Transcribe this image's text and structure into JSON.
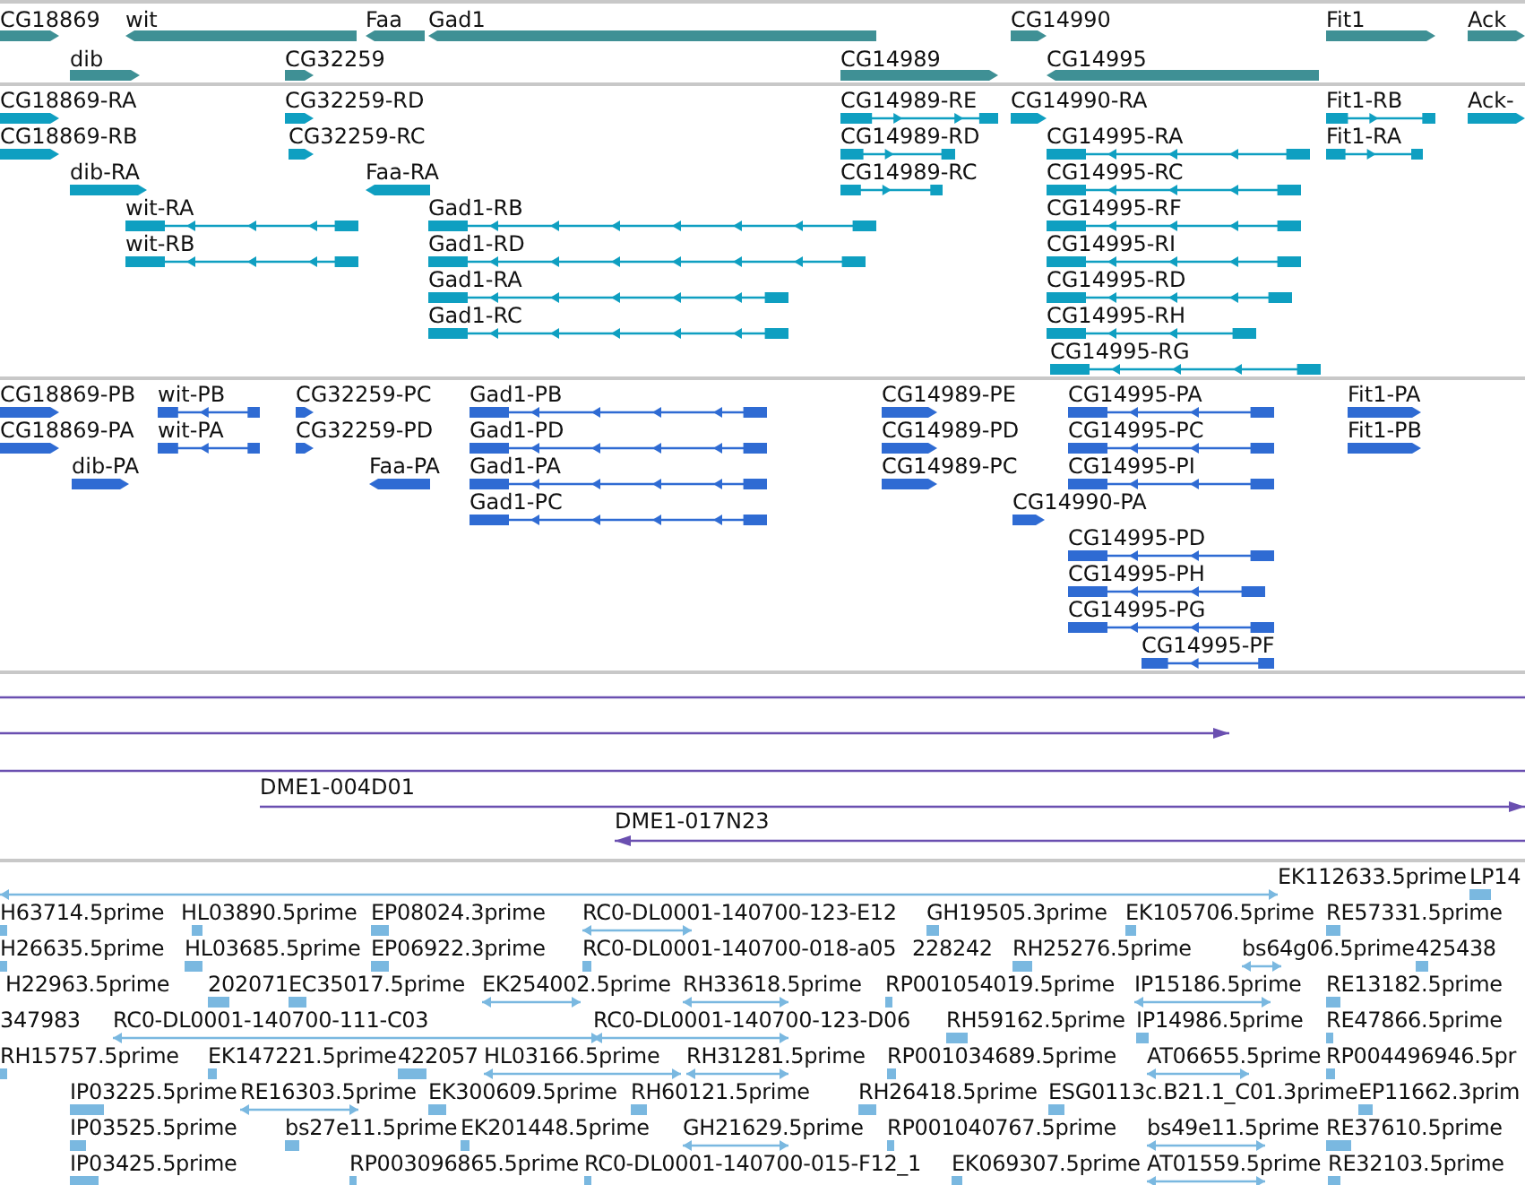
{
  "tracks": [
    {
      "kind": "genes",
      "features": [
        {
          "label": "CG18869",
          "reverse": false
        },
        {
          "label": "wit",
          "reverse": true
        },
        {
          "label": "Faa",
          "reverse": true
        },
        {
          "label": "Gad1",
          "reverse": true
        },
        {
          "label": "CG14990",
          "reverse": false
        },
        {
          "label": "Fit1",
          "reverse": false
        },
        {
          "label": "Ack",
          "reverse": false
        },
        {
          "label": "dib",
          "reverse": false
        },
        {
          "label": "CG32259",
          "reverse": false
        },
        {
          "label": "CG14989",
          "reverse": false
        },
        {
          "label": "CG14995",
          "reverse": true
        }
      ]
    },
    {
      "kind": "transcripts",
      "features": [
        {
          "label": "CG18869-RA",
          "reverse": false
        },
        {
          "label": "CG32259-RD",
          "reverse": false
        },
        {
          "label": "CG14989-RE",
          "reverse": false
        },
        {
          "label": "CG14990-RA",
          "reverse": false
        },
        {
          "label": "Fit1-RB",
          "reverse": false
        },
        {
          "label": "Ack-",
          "reverse": false
        },
        {
          "label": "CG18869-RB",
          "reverse": false
        },
        {
          "label": "CG32259-RC",
          "reverse": false
        },
        {
          "label": "CG14989-RD",
          "reverse": false
        },
        {
          "label": "CG14995-RA",
          "reverse": true
        },
        {
          "label": "Fit1-RA",
          "reverse": false
        },
        {
          "label": "dib-RA",
          "reverse": false
        },
        {
          "label": "Faa-RA",
          "reverse": true
        },
        {
          "label": "CG14989-RC",
          "reverse": false
        },
        {
          "label": "CG14995-RC",
          "reverse": true
        },
        {
          "label": "wit-RA",
          "reverse": true
        },
        {
          "label": "Gad1-RB",
          "reverse": true
        },
        {
          "label": "CG14995-RF",
          "reverse": true
        },
        {
          "label": "wit-RB",
          "reverse": true
        },
        {
          "label": "Gad1-RD",
          "reverse": true
        },
        {
          "label": "CG14995-RI",
          "reverse": true
        },
        {
          "label": "Gad1-RA",
          "reverse": true
        },
        {
          "label": "CG14995-RD",
          "reverse": true
        },
        {
          "label": "Gad1-RC",
          "reverse": true
        },
        {
          "label": "CG14995-RH",
          "reverse": true
        },
        {
          "label": "CG14995-RG",
          "reverse": true
        }
      ]
    },
    {
      "kind": "proteins",
      "features": [
        {
          "label": "CG18869-PB",
          "reverse": false
        },
        {
          "label": "wit-PB",
          "reverse": true
        },
        {
          "label": "CG32259-PC",
          "reverse": false
        },
        {
          "label": "Gad1-PB",
          "reverse": true
        },
        {
          "label": "CG14989-PE",
          "reverse": false
        },
        {
          "label": "CG14995-PA",
          "reverse": true
        },
        {
          "label": "Fit1-PA",
          "reverse": false
        },
        {
          "label": "CG18869-PA",
          "reverse": false
        },
        {
          "label": "wit-PA",
          "reverse": true
        },
        {
          "label": "CG32259-PD",
          "reverse": false
        },
        {
          "label": "Gad1-PD",
          "reverse": true
        },
        {
          "label": "CG14989-PD",
          "reverse": false
        },
        {
          "label": "CG14995-PC",
          "reverse": true
        },
        {
          "label": "Fit1-PB",
          "reverse": false
        },
        {
          "label": "dib-PA",
          "reverse": false
        },
        {
          "label": "Faa-PA",
          "reverse": true
        },
        {
          "label": "Gad1-PA",
          "reverse": true
        },
        {
          "label": "CG14989-PC",
          "reverse": false
        },
        {
          "label": "CG14995-PI",
          "reverse": true
        },
        {
          "label": "Gad1-PC",
          "reverse": true
        },
        {
          "label": "CG14990-PA",
          "reverse": false
        },
        {
          "label": "CG14995-PD",
          "reverse": true
        },
        {
          "label": "CG14995-PH",
          "reverse": true
        },
        {
          "label": "CG14995-PG",
          "reverse": true
        },
        {
          "label": "CG14995-PF",
          "reverse": true
        }
      ]
    },
    {
      "kind": "clones",
      "features": [
        {
          "kind": "through"
        },
        {
          "kind": "clone",
          "reverse": false
        },
        {
          "kind": "through"
        },
        {
          "kind": "clone",
          "label": "DME1-004D01",
          "reverse": false
        },
        {
          "kind": "clone",
          "label": "DME1-017N23",
          "reverse": true
        }
      ]
    },
    {
      "kind": "ests",
      "features": [
        {
          "label": "EK112633.5prime"
        },
        {
          "label": "LP14"
        },
        {
          "label": "H63714.5prime"
        },
        {
          "label": "HL03890.5prime"
        },
        {
          "label": "EP08024.3prime"
        },
        {
          "label": "RC0-DL0001-140700-123-E12"
        },
        {
          "label": "GH19505.3prime"
        },
        {
          "label": "EK105706.5prime"
        },
        {
          "label": "RE57331.5prime"
        },
        {
          "label": "H26635.5prime"
        },
        {
          "label": "HL03685.5prime"
        },
        {
          "label": "EP06922.3prime"
        },
        {
          "label": "RC0-DL0001-140700-018-a05"
        },
        {
          "label": "228242"
        },
        {
          "label": "RH25276.5prime"
        },
        {
          "label": "bs64g06.5prime"
        },
        {
          "label": "425438"
        },
        {
          "label": "H22963.5prime"
        },
        {
          "label": "202071"
        },
        {
          "label": "EC35017.5prime"
        },
        {
          "label": "EK254002.5prime"
        },
        {
          "label": "RH33618.5prime"
        },
        {
          "label": "RP001054019.5prime"
        },
        {
          "label": "IP15186.5prime"
        },
        {
          "label": "RE13182.5prime"
        },
        {
          "label": "347983"
        },
        {
          "label": "RC0-DL0001-140700-111-C03"
        },
        {
          "label": "RC0-DL0001-140700-123-D06"
        },
        {
          "label": "RH59162.5prime"
        },
        {
          "label": "IP14986.5prime"
        },
        {
          "label": "RE47866.5prime"
        },
        {
          "label": "RH15757.5prime"
        },
        {
          "label": "EK147221.5prime"
        },
        {
          "label": "422057"
        },
        {
          "label": "HL03166.5prime"
        },
        {
          "label": "RH31281.5prime"
        },
        {
          "label": "RP001034689.5prime"
        },
        {
          "label": "AT06655.5prime"
        },
        {
          "label": "RP004496946.5pr"
        },
        {
          "label": "IP03225.5prime"
        },
        {
          "label": "RE16303.5prime"
        },
        {
          "label": "EK300609.5prime"
        },
        {
          "label": "RH60121.5prime"
        },
        {
          "label": "RH26418.5prime"
        },
        {
          "label": "ESG0113c.B21.1_C01.3prime"
        },
        {
          "label": "EP11662.3prim"
        },
        {
          "label": "IP03525.5prime"
        },
        {
          "label": "bs27e11.5prime"
        },
        {
          "label": "EK201448.5prime"
        },
        {
          "label": "GH21629.5prime"
        },
        {
          "label": "RP001040767.5prime"
        },
        {
          "label": "bs49e11.5prime"
        },
        {
          "label": "RE37610.5prime"
        },
        {
          "label": "IP03425.5prime"
        },
        {
          "label": "RP003096865.5prime"
        },
        {
          "label": "RC0-DL0001-140700-015-F12_1"
        },
        {
          "label": "EK069307.5prime"
        },
        {
          "label": "AT01559.5prime"
        },
        {
          "label": "RE32103.5prime"
        }
      ]
    }
  ]
}
